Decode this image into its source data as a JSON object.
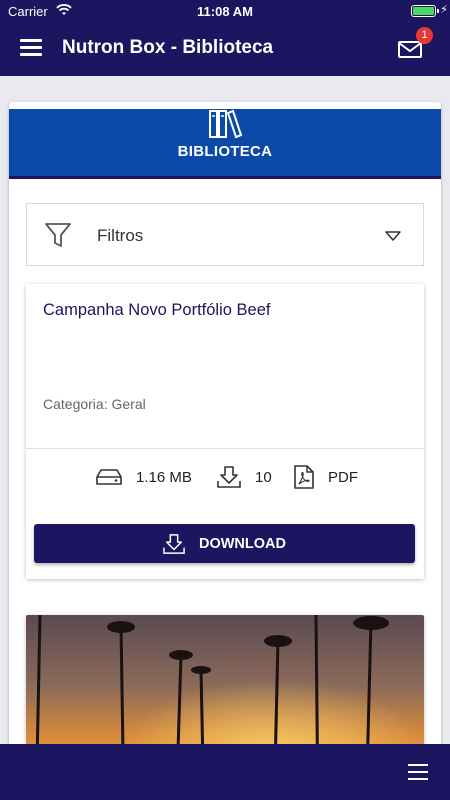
{
  "status_bar": {
    "carrier": "Carrier",
    "time": "11:08 AM"
  },
  "nav": {
    "title": "Nutron Box - Biblioteca",
    "badge_count": "1",
    "menu_icon": "hamburger-icon",
    "mail_icon": "mail-icon"
  },
  "panel": {
    "title": "BIBLIOTECA",
    "icon": "books-icon"
  },
  "filters": {
    "label": "Filtros",
    "icon": "filter-icon"
  },
  "item": {
    "title": "Campanha Novo Portfólio Beef",
    "category": "Categoria: Geral",
    "size": "1.16 MB",
    "downloads": "10",
    "format": "PDF",
    "download_label": "DOWNLOAD"
  },
  "colors": {
    "primary": "#1c1560",
    "header_blue": "#0b4aa6",
    "badge": "#e53935"
  }
}
